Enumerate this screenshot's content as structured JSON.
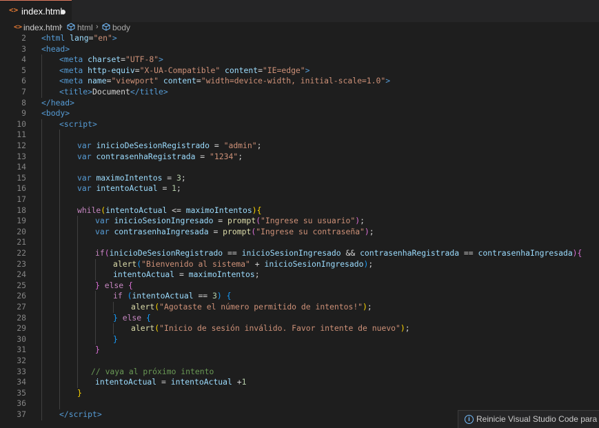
{
  "tab": {
    "icon": "<>",
    "label": "index.html"
  },
  "breadcrumb": {
    "file_icon": "<>",
    "file": "index.html",
    "sep": "›",
    "item1": "html",
    "item2": "body"
  },
  "code_lines": [
    {
      "n": "2",
      "indent": 0,
      "tokens": [
        [
          "t-tag",
          "<"
        ],
        [
          "t-tag",
          "html"
        ],
        [
          "t-txt",
          " "
        ],
        [
          "t-attr",
          "lang"
        ],
        [
          "t-txt",
          "="
        ],
        [
          "t-str",
          "\"en\""
        ],
        [
          "t-tag",
          ">"
        ]
      ]
    },
    {
      "n": "3",
      "indent": 0,
      "tokens": [
        [
          "t-tag",
          "<head>"
        ]
      ]
    },
    {
      "n": "4",
      "indent": 1,
      "tokens": [
        [
          "t-tag",
          "<meta"
        ],
        [
          "t-txt",
          " "
        ],
        [
          "t-attr",
          "charset"
        ],
        [
          "t-txt",
          "="
        ],
        [
          "t-str",
          "\"UTF-8\""
        ],
        [
          "t-tag",
          ">"
        ]
      ]
    },
    {
      "n": "5",
      "indent": 1,
      "tokens": [
        [
          "t-tag",
          "<meta"
        ],
        [
          "t-txt",
          " "
        ],
        [
          "t-attr",
          "http-equiv"
        ],
        [
          "t-txt",
          "="
        ],
        [
          "t-str",
          "\"X-UA-Compatible\""
        ],
        [
          "t-txt",
          " "
        ],
        [
          "t-attr",
          "content"
        ],
        [
          "t-txt",
          "="
        ],
        [
          "t-str",
          "\"IE=edge\""
        ],
        [
          "t-tag",
          ">"
        ]
      ]
    },
    {
      "n": "6",
      "indent": 1,
      "tokens": [
        [
          "t-tag",
          "<meta"
        ],
        [
          "t-txt",
          " "
        ],
        [
          "t-attr",
          "name"
        ],
        [
          "t-txt",
          "="
        ],
        [
          "t-str",
          "\"viewport\""
        ],
        [
          "t-txt",
          " "
        ],
        [
          "t-attr",
          "content"
        ],
        [
          "t-txt",
          "="
        ],
        [
          "t-str",
          "\"width=device-width, initial-scale=1.0\""
        ],
        [
          "t-tag",
          ">"
        ]
      ]
    },
    {
      "n": "7",
      "indent": 1,
      "tokens": [
        [
          "t-tag",
          "<title>"
        ],
        [
          "t-txt",
          "Document"
        ],
        [
          "t-tag",
          "</title>"
        ]
      ]
    },
    {
      "n": "8",
      "indent": 0,
      "tokens": [
        [
          "t-tag",
          "</head>"
        ]
      ]
    },
    {
      "n": "9",
      "indent": 0,
      "tokens": [
        [
          "t-tag",
          "<body>"
        ]
      ]
    },
    {
      "n": "10",
      "indent": 1,
      "tokens": [
        [
          "t-tag",
          "<script>"
        ]
      ]
    },
    {
      "n": "11",
      "indent": 2,
      "tokens": []
    },
    {
      "n": "12",
      "indent": 2,
      "tokens": [
        [
          "t-kw",
          "var"
        ],
        [
          "t-txt",
          " "
        ],
        [
          "t-var",
          "inicioDeSesionRegistrado"
        ],
        [
          "t-txt",
          " = "
        ],
        [
          "t-str",
          "\"admin\""
        ],
        [
          "t-txt",
          ";"
        ]
      ]
    },
    {
      "n": "13",
      "indent": 2,
      "tokens": [
        [
          "t-kw",
          "var"
        ],
        [
          "t-txt",
          " "
        ],
        [
          "t-var",
          "contrasenhaRegistrada"
        ],
        [
          "t-txt",
          " = "
        ],
        [
          "t-str",
          "\"1234\""
        ],
        [
          "t-txt",
          ";"
        ]
      ]
    },
    {
      "n": "14",
      "indent": 2,
      "tokens": []
    },
    {
      "n": "15",
      "indent": 2,
      "tokens": [
        [
          "t-kw",
          "var"
        ],
        [
          "t-txt",
          " "
        ],
        [
          "t-var",
          "maximoIntentos"
        ],
        [
          "t-txt",
          " = "
        ],
        [
          "t-num",
          "3"
        ],
        [
          "t-txt",
          ";"
        ]
      ]
    },
    {
      "n": "16",
      "indent": 2,
      "tokens": [
        [
          "t-kw",
          "var"
        ],
        [
          "t-txt",
          " "
        ],
        [
          "t-var",
          "intentoActual"
        ],
        [
          "t-txt",
          " = "
        ],
        [
          "t-num",
          "1"
        ],
        [
          "t-txt",
          ";"
        ]
      ]
    },
    {
      "n": "17",
      "indent": 2,
      "tokens": []
    },
    {
      "n": "18",
      "indent": 2,
      "tokens": [
        [
          "t-ctrl",
          "while"
        ],
        [
          "t-br1",
          "("
        ],
        [
          "t-var",
          "intentoActual"
        ],
        [
          "t-txt",
          " <= "
        ],
        [
          "t-var",
          "maximoIntentos"
        ],
        [
          "t-br1",
          ")"
        ],
        [
          "t-br1",
          "{"
        ]
      ]
    },
    {
      "n": "19",
      "indent": 3,
      "tokens": [
        [
          "t-kw",
          "var"
        ],
        [
          "t-txt",
          " "
        ],
        [
          "t-var",
          "inicioSesionIngresado"
        ],
        [
          "t-txt",
          " = "
        ],
        [
          "t-fn",
          "prompt"
        ],
        [
          "t-br2",
          "("
        ],
        [
          "t-str",
          "\"Ingrese su usuario\""
        ],
        [
          "t-br2",
          ")"
        ],
        [
          "t-txt",
          ";"
        ]
      ]
    },
    {
      "n": "20",
      "indent": 3,
      "tokens": [
        [
          "t-kw",
          "var"
        ],
        [
          "t-txt",
          " "
        ],
        [
          "t-var",
          "contrasenhaIngresada"
        ],
        [
          "t-txt",
          " = "
        ],
        [
          "t-fn",
          "prompt"
        ],
        [
          "t-br2",
          "("
        ],
        [
          "t-str",
          "\"Ingrese su contraseña\""
        ],
        [
          "t-br2",
          ")"
        ],
        [
          "t-txt",
          ";"
        ]
      ]
    },
    {
      "n": "21",
      "indent": 3,
      "tokens": []
    },
    {
      "n": "22",
      "indent": 3,
      "tokens": [
        [
          "t-ctrl",
          "if"
        ],
        [
          "t-br2",
          "("
        ],
        [
          "t-var",
          "inicioDeSesionRegistrado"
        ],
        [
          "t-txt",
          " == "
        ],
        [
          "t-var",
          "inicioSesionIngresado"
        ],
        [
          "t-txt",
          " && "
        ],
        [
          "t-var",
          "contrasenhaRegistrada"
        ],
        [
          "t-txt",
          " == "
        ],
        [
          "t-var",
          "contrasenhaIngresada"
        ],
        [
          "t-br2",
          ")"
        ],
        [
          "t-br2",
          "{"
        ]
      ]
    },
    {
      "n": "23",
      "indent": 4,
      "tokens": [
        [
          "t-fn",
          "alert"
        ],
        [
          "t-br3",
          "("
        ],
        [
          "t-str",
          "\"Bienvenido al sistema\""
        ],
        [
          "t-txt",
          " + "
        ],
        [
          "t-var",
          "inicioSesionIngresado"
        ],
        [
          "t-br3",
          ")"
        ],
        [
          "t-txt",
          ";"
        ]
      ]
    },
    {
      "n": "24",
      "indent": 4,
      "tokens": [
        [
          "t-var",
          "intentoActual"
        ],
        [
          "t-txt",
          " = "
        ],
        [
          "t-var",
          "maximoIntentos"
        ],
        [
          "t-txt",
          ";"
        ]
      ]
    },
    {
      "n": "25",
      "indent": 3,
      "tokens": [
        [
          "t-br2",
          "}"
        ],
        [
          "t-txt",
          " "
        ],
        [
          "t-ctrl",
          "else"
        ],
        [
          "t-txt",
          " "
        ],
        [
          "t-br2",
          "{"
        ]
      ]
    },
    {
      "n": "26",
      "indent": 4,
      "tokens": [
        [
          "t-ctrl",
          "if"
        ],
        [
          "t-txt",
          " "
        ],
        [
          "t-br3",
          "("
        ],
        [
          "t-var",
          "intentoActual"
        ],
        [
          "t-txt",
          " == "
        ],
        [
          "t-num",
          "3"
        ],
        [
          "t-br3",
          ")"
        ],
        [
          "t-txt",
          " "
        ],
        [
          "t-br3",
          "{"
        ]
      ]
    },
    {
      "n": "27",
      "indent": 5,
      "tokens": [
        [
          "t-fn",
          "alert"
        ],
        [
          "t-br1",
          "("
        ],
        [
          "t-str",
          "\"Agotaste el número permitido de intentos!\""
        ],
        [
          "t-br1",
          ")"
        ],
        [
          "t-txt",
          ";"
        ]
      ]
    },
    {
      "n": "28",
      "indent": 4,
      "tokens": [
        [
          "t-br3",
          "}"
        ],
        [
          "t-txt",
          " "
        ],
        [
          "t-ctrl",
          "else"
        ],
        [
          "t-txt",
          " "
        ],
        [
          "t-br3",
          "{"
        ]
      ]
    },
    {
      "n": "29",
      "indent": 5,
      "tokens": [
        [
          "t-fn",
          "alert"
        ],
        [
          "t-br1",
          "("
        ],
        [
          "t-str",
          "\"Inicio de sesión inválido. Favor intente de nuevo\""
        ],
        [
          "t-br1",
          ")"
        ],
        [
          "t-txt",
          ";"
        ]
      ]
    },
    {
      "n": "30",
      "indent": 4,
      "tokens": [
        [
          "t-br3",
          "}"
        ]
      ]
    },
    {
      "n": "31",
      "indent": 3,
      "tokens": [
        [
          "t-br2",
          "}"
        ]
      ]
    },
    {
      "n": "32",
      "indent": 3,
      "tokens": []
    },
    {
      "n": "33",
      "indent": 3,
      "tokens": [
        [
          "t-cmt",
          "// vaya al próximo intento"
        ]
      ],
      "offset": -6
    },
    {
      "n": "34",
      "indent": 3,
      "tokens": [
        [
          "t-var",
          "intentoActual"
        ],
        [
          "t-txt",
          " = "
        ],
        [
          "t-var",
          "intentoActual"
        ],
        [
          "t-txt",
          " +"
        ],
        [
          "t-num",
          "1"
        ]
      ]
    },
    {
      "n": "35",
      "indent": 2,
      "tokens": [
        [
          "t-br1",
          "}"
        ]
      ]
    },
    {
      "n": "36",
      "indent": 2,
      "tokens": []
    },
    {
      "n": "37",
      "indent": 1,
      "tokens": [
        [
          "t-tag",
          "</"
        ],
        [
          "t-tag",
          "script"
        ],
        [
          "t-tag",
          ">"
        ]
      ]
    }
  ],
  "notification": {
    "icon": "i",
    "text": "Reinicie Visual Studio Code para aplic"
  }
}
